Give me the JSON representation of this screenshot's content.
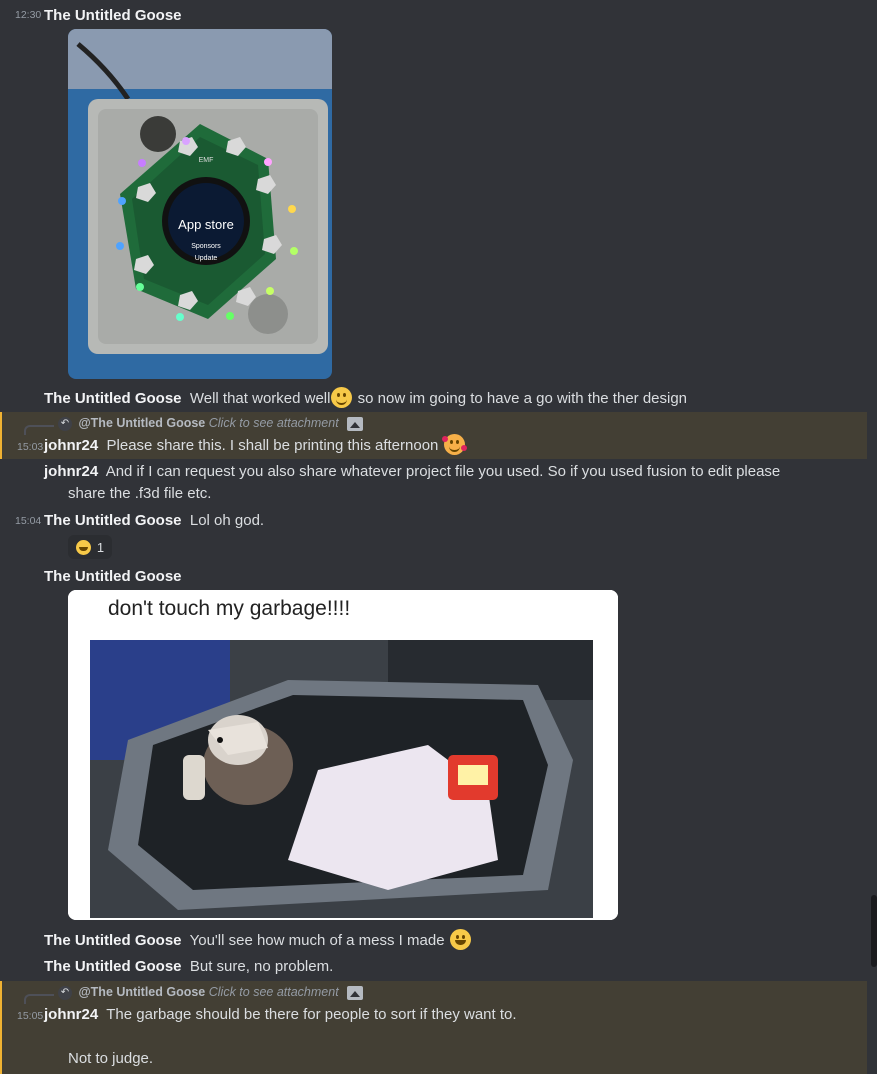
{
  "messages": [
    {
      "time": "12:30",
      "author": "The Untitled Goose"
    },
    {
      "author": "The Untitled Goose",
      "text_before": "Well that worked well",
      "text_after": "so now im going to have a go with the ther design"
    },
    {
      "reply_to": "@The Untitled Goose",
      "reply_hint": "Click to see attachment",
      "time": "15:03",
      "author": "johnr24",
      "text": "Please share this. I shall be printing this afternoon"
    },
    {
      "author": "johnr24",
      "text_line1": "And if I can request you also share whatever project file you used. So if you used fusion to edit please",
      "text_line2": "share the .f3d file etc."
    },
    {
      "time": "15:04",
      "author": "The Untitled Goose",
      "text": "Lol oh god."
    },
    {
      "reaction_count": "1"
    },
    {
      "author": "The Untitled Goose"
    },
    {
      "author": "The Untitled Goose",
      "text": "You'll see how much of a mess I made"
    },
    {
      "author": "The Untitled Goose",
      "text": "But sure, no problem."
    },
    {
      "reply_to": "@The Untitled Goose",
      "reply_hint": "Click to see attachment",
      "time": "15:05",
      "author": "johnr24",
      "text_line1": "The garbage should be there for people to sort if they want to.",
      "text_line2": "Not to judge."
    }
  ],
  "device_image": {
    "screen_title": "App store",
    "menu_item1": "Sponsors",
    "menu_item2": "Update",
    "logo": "EMF"
  },
  "meme": {
    "caption": "don't touch my garbage!!!!"
  }
}
